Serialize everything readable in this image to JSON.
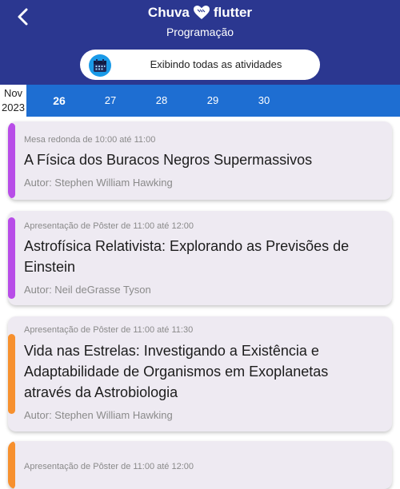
{
  "header": {
    "brand_left": "Chuva",
    "brand_right": "flutter",
    "subtitle": "Programação",
    "filter_label": "Exibindo todas as atividades"
  },
  "date_bar": {
    "month": "Nov",
    "year": "2023",
    "days": [
      "26",
      "27",
      "28",
      "29",
      "30"
    ],
    "selected_day": "26"
  },
  "activities": [
    {
      "meta": "Mesa redonda de 10:00 até 11:00",
      "title": "A Física dos Buracos Negros Supermassivos",
      "author": "Autor: Stephen William Hawking",
      "color": "#b84de8"
    },
    {
      "meta": "Apresentação de Pôster de 11:00 até 12:00",
      "title": "Astrofísica Relativista: Explorando as Previsões de Einstein",
      "author": "Autor:  Neil deGrasse Tyson",
      "color": "#b84de8"
    },
    {
      "meta": "Apresentação de Pôster de 11:00 até 11:30",
      "title": "Vida nas Estrelas: Investigando a Existência e Adaptabilidade de Organismos em Exoplanetas através da Astrobiologia",
      "author": "Autor: Stephen William Hawking",
      "color": "#f7902e"
    },
    {
      "meta": "Apresentação de Pôster de 11:00 até 12:00",
      "color": "#f7902e"
    }
  ],
  "colors": {
    "header_bg": "#2b3790",
    "date_bar_bg": "#1e6ed2",
    "card_bg": "#eeeaf2",
    "calendar_icon_bg": "#1a9ae8"
  },
  "icons": {
    "back": "arrow-back-icon",
    "heart": "heart-icon",
    "calendar": "calendar-icon"
  }
}
